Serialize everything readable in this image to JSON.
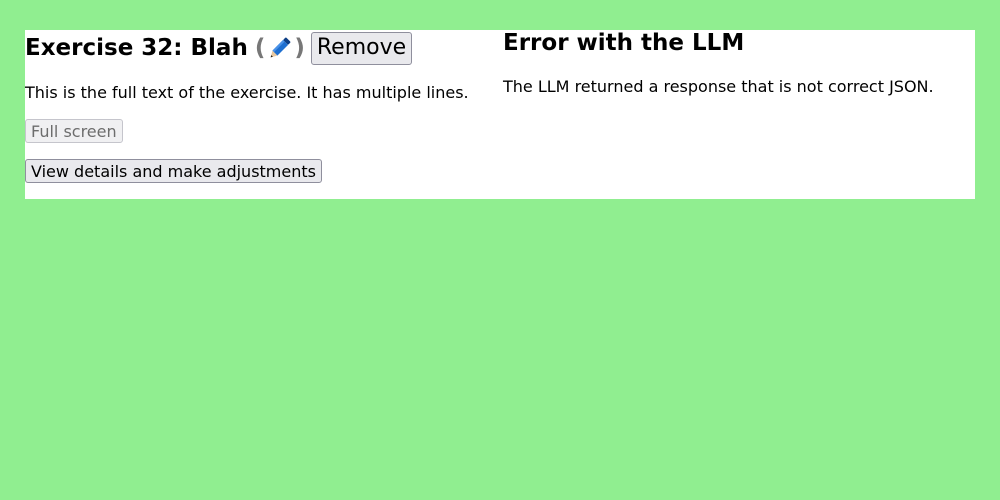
{
  "exercise": {
    "title": "Exercise 32: Blah",
    "edit_open": "(",
    "edit_icon": "pencil-icon",
    "edit_close": ")",
    "remove_label": "Remove",
    "text": "This is the full text of the exercise. It has multiple lines.",
    "fullscreen_label": "Full screen",
    "details_label": "View details and make adjustments"
  },
  "error": {
    "title": "Error with the LLM",
    "message": "The LLM returned a response that is not correct JSON."
  },
  "colors": {
    "page_background": "#90ee90",
    "panel_background": "#ffffff",
    "pencil_blue": "#1e6fd0"
  }
}
